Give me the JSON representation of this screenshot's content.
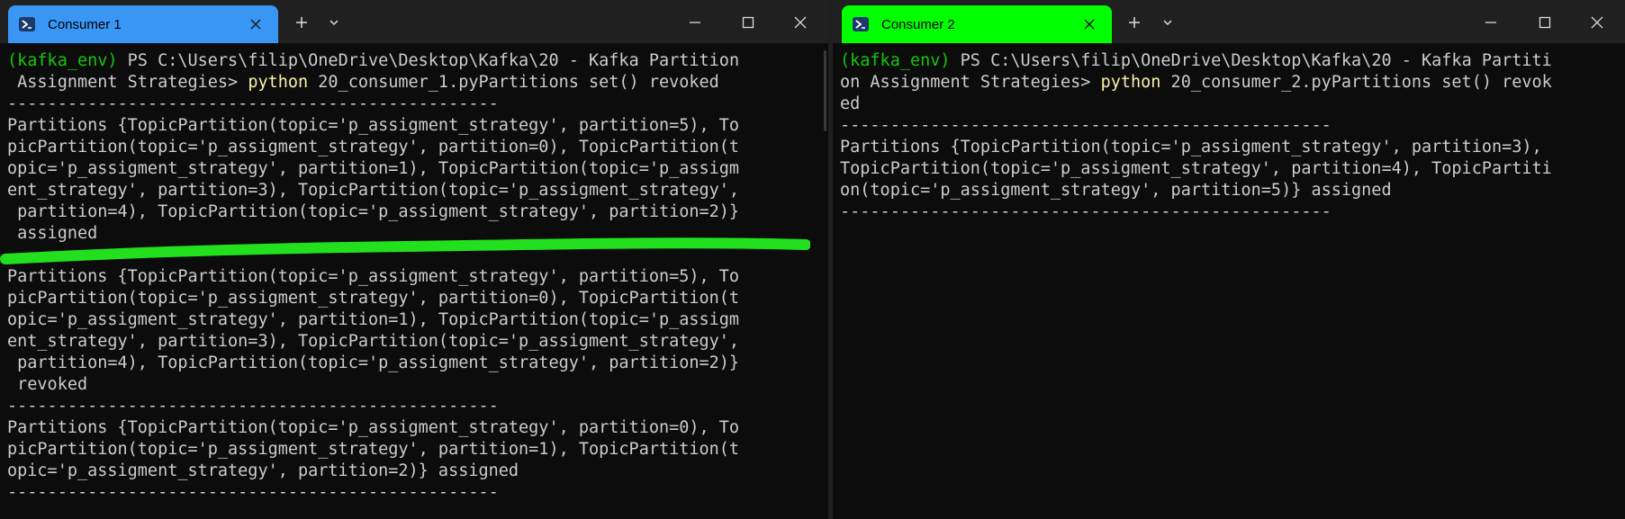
{
  "colors": {
    "background": "#0c0c0c",
    "titlebar": "#202020",
    "tab1_bg": "#3a96f5",
    "tab2_bg": "#00ff00",
    "text": "#cccccc",
    "prompt_env": "#16c60c",
    "command": "#f9f1a5",
    "marker": "#22e01e"
  },
  "icons": {
    "tab": "powershell-icon",
    "close_tab": "close-icon",
    "new_tab": "plus-icon",
    "dropdown": "chevron-down-icon",
    "minimize": "minimize-icon",
    "maximize": "maximize-icon",
    "close_window": "close-icon"
  },
  "windows": [
    {
      "tab_title": "Consumer 1",
      "lines": [
        {
          "env": "(kafka_env)",
          "text": " PS C:\\Users\\filip\\OneDrive\\Desktop\\Kafka\\20 - Kafka Partition"
        },
        {
          "text": " Assignment Strategies> ",
          "cmd": "python",
          "rest": " 20_consumer_1.pyPartitions set() revoked"
        },
        {
          "text": "-------------------------------------------------"
        },
        {
          "text": "Partitions {TopicPartition(topic='p_assigment_strategy', partition=5), To"
        },
        {
          "text": "picPartition(topic='p_assigment_strategy', partition=0), TopicPartition(t"
        },
        {
          "text": "opic='p_assigment_strategy', partition=1), TopicPartition(topic='p_assigm"
        },
        {
          "text": "ent_strategy', partition=3), TopicPartition(topic='p_assigment_strategy',"
        },
        {
          "text": " partition=4), TopicPartition(topic='p_assigment_strategy', partition=2)}"
        },
        {
          "text": " assigned"
        },
        {
          "text": "---"
        },
        {
          "text": "Partitions {TopicPartition(topic='p_assigment_strategy', partition=5), To"
        },
        {
          "text": "picPartition(topic='p_assigment_strategy', partition=0), TopicPartition(t"
        },
        {
          "text": "opic='p_assigment_strategy', partition=1), TopicPartition(topic='p_assigm"
        },
        {
          "text": "ent_strategy', partition=3), TopicPartition(topic='p_assigment_strategy',"
        },
        {
          "text": " partition=4), TopicPartition(topic='p_assigment_strategy', partition=2)}"
        },
        {
          "text": " revoked"
        },
        {
          "text": "-------------------------------------------------"
        },
        {
          "text": "Partitions {TopicPartition(topic='p_assigment_strategy', partition=0), To"
        },
        {
          "text": "picPartition(topic='p_assigment_strategy', partition=1), TopicPartition(t"
        },
        {
          "text": "opic='p_assigment_strategy', partition=2)} assigned"
        },
        {
          "text": "-------------------------------------------------"
        }
      ]
    },
    {
      "tab_title": "Consumer 2",
      "lines": [
        {
          "env": "(kafka_env)",
          "text": " PS C:\\Users\\filip\\OneDrive\\Desktop\\Kafka\\20 - Kafka Partiti"
        },
        {
          "text": "on Assignment Strategies> ",
          "cmd": "python",
          "rest": " 20_consumer_2.pyPartitions set() revok"
        },
        {
          "text": "ed"
        },
        {
          "text": "-------------------------------------------------"
        },
        {
          "text": "Partitions {TopicPartition(topic='p_assigment_strategy', partition=3),"
        },
        {
          "text": "TopicPartition(topic='p_assigment_strategy', partition=4), TopicPartiti"
        },
        {
          "text": "on(topic='p_assigment_strategy', partition=5)} assigned"
        },
        {
          "text": "-------------------------------------------------"
        }
      ]
    }
  ]
}
